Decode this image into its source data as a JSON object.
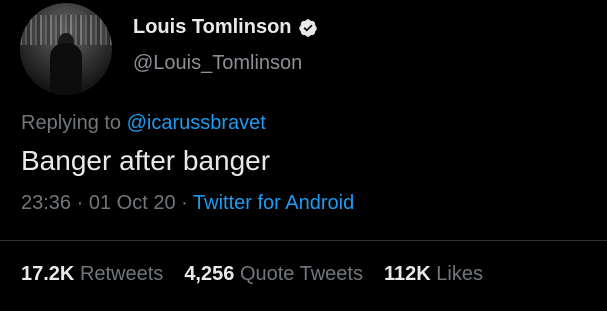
{
  "author": {
    "display_name": "Louis Tomlinson",
    "handle": "@Louis_Tomlinson",
    "verified_icon": "verified-badge-icon"
  },
  "reply": {
    "prefix": "Replying to",
    "mention": "@icarussbravet"
  },
  "tweet": {
    "text": "Banger after banger"
  },
  "meta": {
    "time": "23:36",
    "date": "01 Oct 20",
    "separator": "·",
    "source": "Twitter for Android"
  },
  "stats": {
    "retweets_count": "17.2K",
    "retweets_label": "Retweets",
    "quotes_count": "4,256",
    "quotes_label": "Quote Tweets",
    "likes_count": "112K",
    "likes_label": "Likes"
  },
  "colors": {
    "background": "#000000",
    "accent": "#1d9bf0",
    "secondary_text": "#71767b",
    "primary_text": "#e7e9ea"
  }
}
